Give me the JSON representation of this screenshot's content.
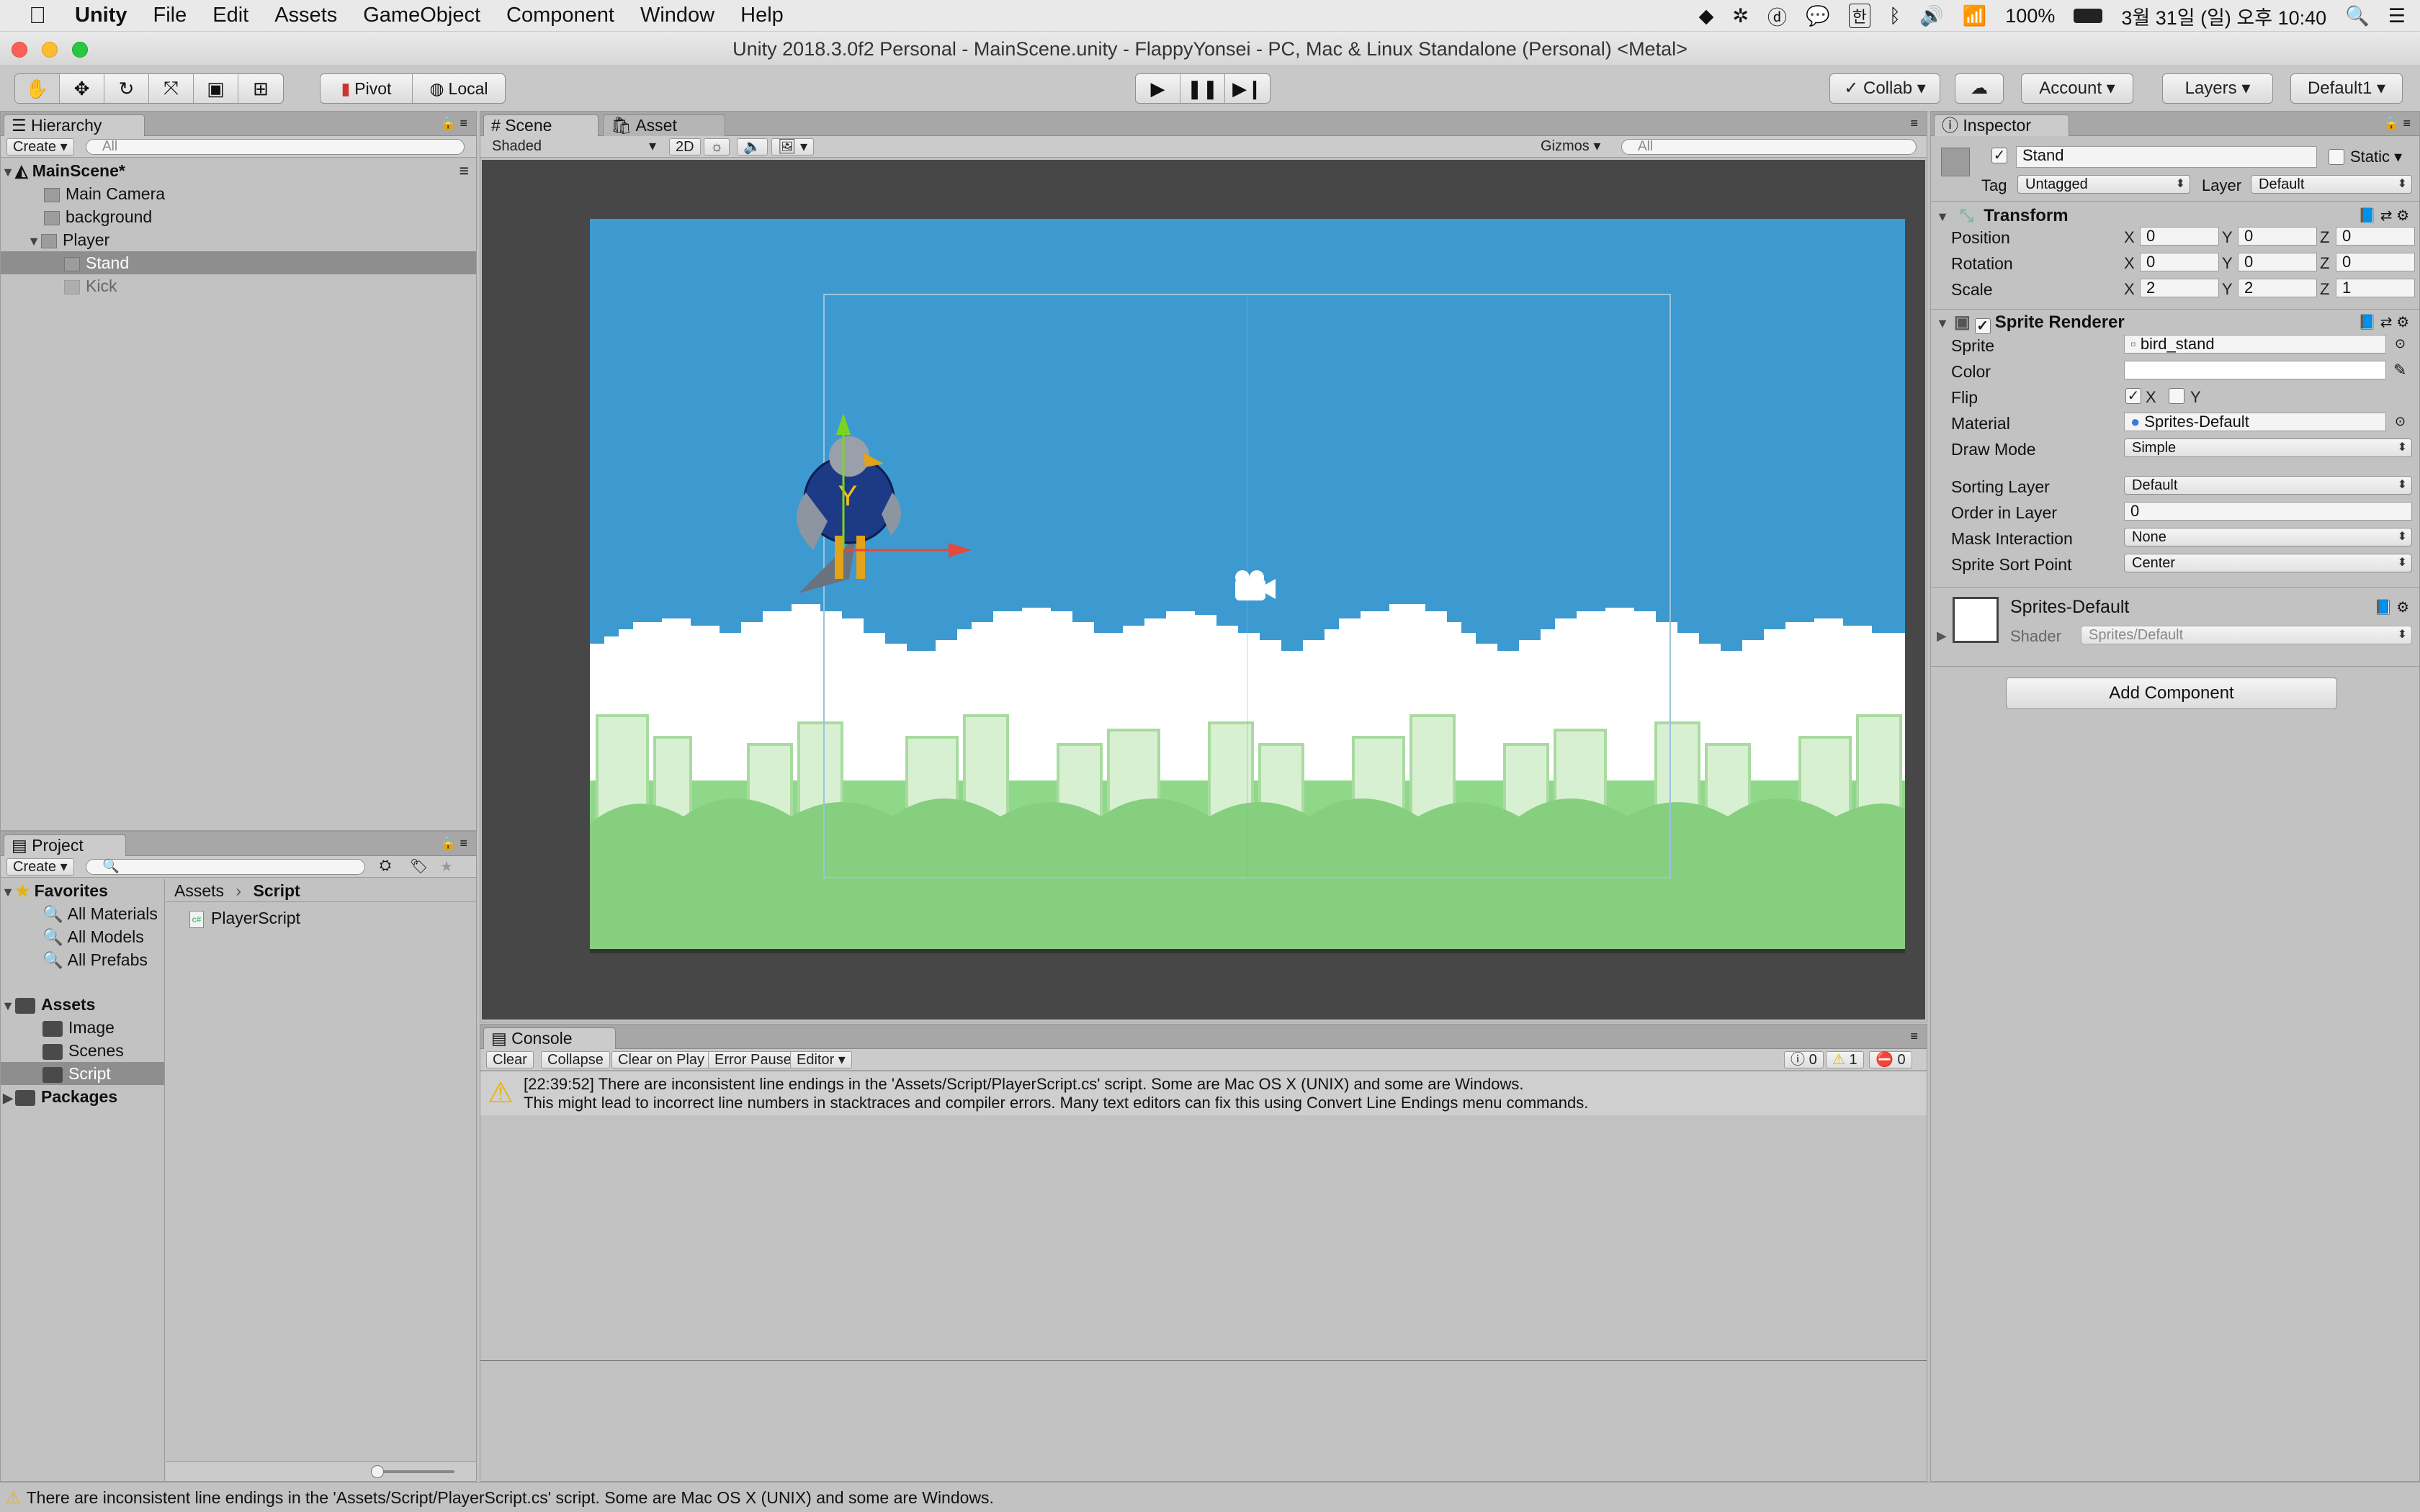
{
  "menubar": {
    "app": "Unity",
    "items": [
      "File",
      "Edit",
      "Assets",
      "GameObject",
      "Component",
      "Window",
      "Help"
    ],
    "battery": "100%",
    "datetime": "3월 31일 (일) 오후 10:40"
  },
  "window": {
    "title": "Unity 2018.3.0f2 Personal - MainScene.unity - FlappyYonsei - PC, Mac & Linux Standalone (Personal) <Metal>"
  },
  "toolbar": {
    "pivot": "Pivot",
    "local": "Local",
    "collab": "Collab",
    "account": "Account",
    "layers": "Layers",
    "layout": "Default1"
  },
  "hierarchy": {
    "tab": "Hierarchy",
    "create": "Create",
    "search_placeholder": "All",
    "scene": "MainScene*",
    "items": [
      "Main Camera",
      "background",
      "Player",
      "Stand",
      "Kick"
    ]
  },
  "project": {
    "tab": "Project",
    "create": "Create",
    "favorites": "Favorites",
    "fav_items": [
      "All Materials",
      "All Models",
      "All Prefabs"
    ],
    "assets": "Assets",
    "asset_items": [
      "Image",
      "Scenes",
      "Script"
    ],
    "packages": "Packages",
    "breadcrumb": [
      "Assets",
      "Script"
    ],
    "files": [
      "PlayerScript"
    ]
  },
  "scene": {
    "tabs": [
      "Scene",
      "Asset Store"
    ],
    "shading": "Shaded",
    "mode2d": "2D",
    "gizmos": "Gizmos",
    "search_placeholder": "All"
  },
  "console": {
    "tab": "Console",
    "buttons": [
      "Clear",
      "Collapse",
      "Clear on Play",
      "Error Pause",
      "Editor"
    ],
    "counts": {
      "info": "0",
      "warn": "1",
      "error": "0"
    },
    "message_line1": "[22:39:52] There are inconsistent line endings in the 'Assets/Script/PlayerScript.cs' script. Some are Mac OS X (UNIX) and some are Windows.",
    "message_line2": "This might lead to incorrect line numbers in stacktraces and compiler errors. Many text editors can fix this using Convert Line Endings menu commands."
  },
  "inspector": {
    "tab": "Inspector",
    "name": "Stand",
    "static": "Static",
    "tag_label": "Tag",
    "tag": "Untagged",
    "layer_label": "Layer",
    "layer": "Default",
    "transform": {
      "title": "Transform",
      "rows": [
        {
          "label": "Position",
          "x": "0",
          "y": "0",
          "z": "0"
        },
        {
          "label": "Rotation",
          "x": "0",
          "y": "0",
          "z": "0"
        },
        {
          "label": "Scale",
          "x": "2",
          "y": "2",
          "z": "1"
        }
      ]
    },
    "sprite_renderer": {
      "title": "Sprite Renderer",
      "sprite_label": "Sprite",
      "sprite": "bird_stand",
      "color_label": "Color",
      "flip_label": "Flip",
      "flip_x": "X",
      "flip_y": "Y",
      "material_label": "Material",
      "material": "Sprites-Default",
      "drawmode_label": "Draw Mode",
      "drawmode": "Simple",
      "sortinglayer_label": "Sorting Layer",
      "sortinglayer": "Default",
      "order_label": "Order in Layer",
      "order": "0",
      "mask_label": "Mask Interaction",
      "mask": "None",
      "sortpoint_label": "Sprite Sort Point",
      "sortpoint": "Center"
    },
    "material": {
      "title": "Sprites-Default",
      "shader_label": "Shader",
      "shader": "Sprites/Default"
    },
    "add_component": "Add Component"
  },
  "statusbar": {
    "text": "There are inconsistent line endings in the 'Assets/Script/PlayerScript.cs' script. Some are Mac OS X (UNIX) and some are Windows."
  },
  "colors": {
    "sky": "#3d9ad1",
    "grass": "#8fd88a",
    "selection": "#8e8e8e"
  }
}
